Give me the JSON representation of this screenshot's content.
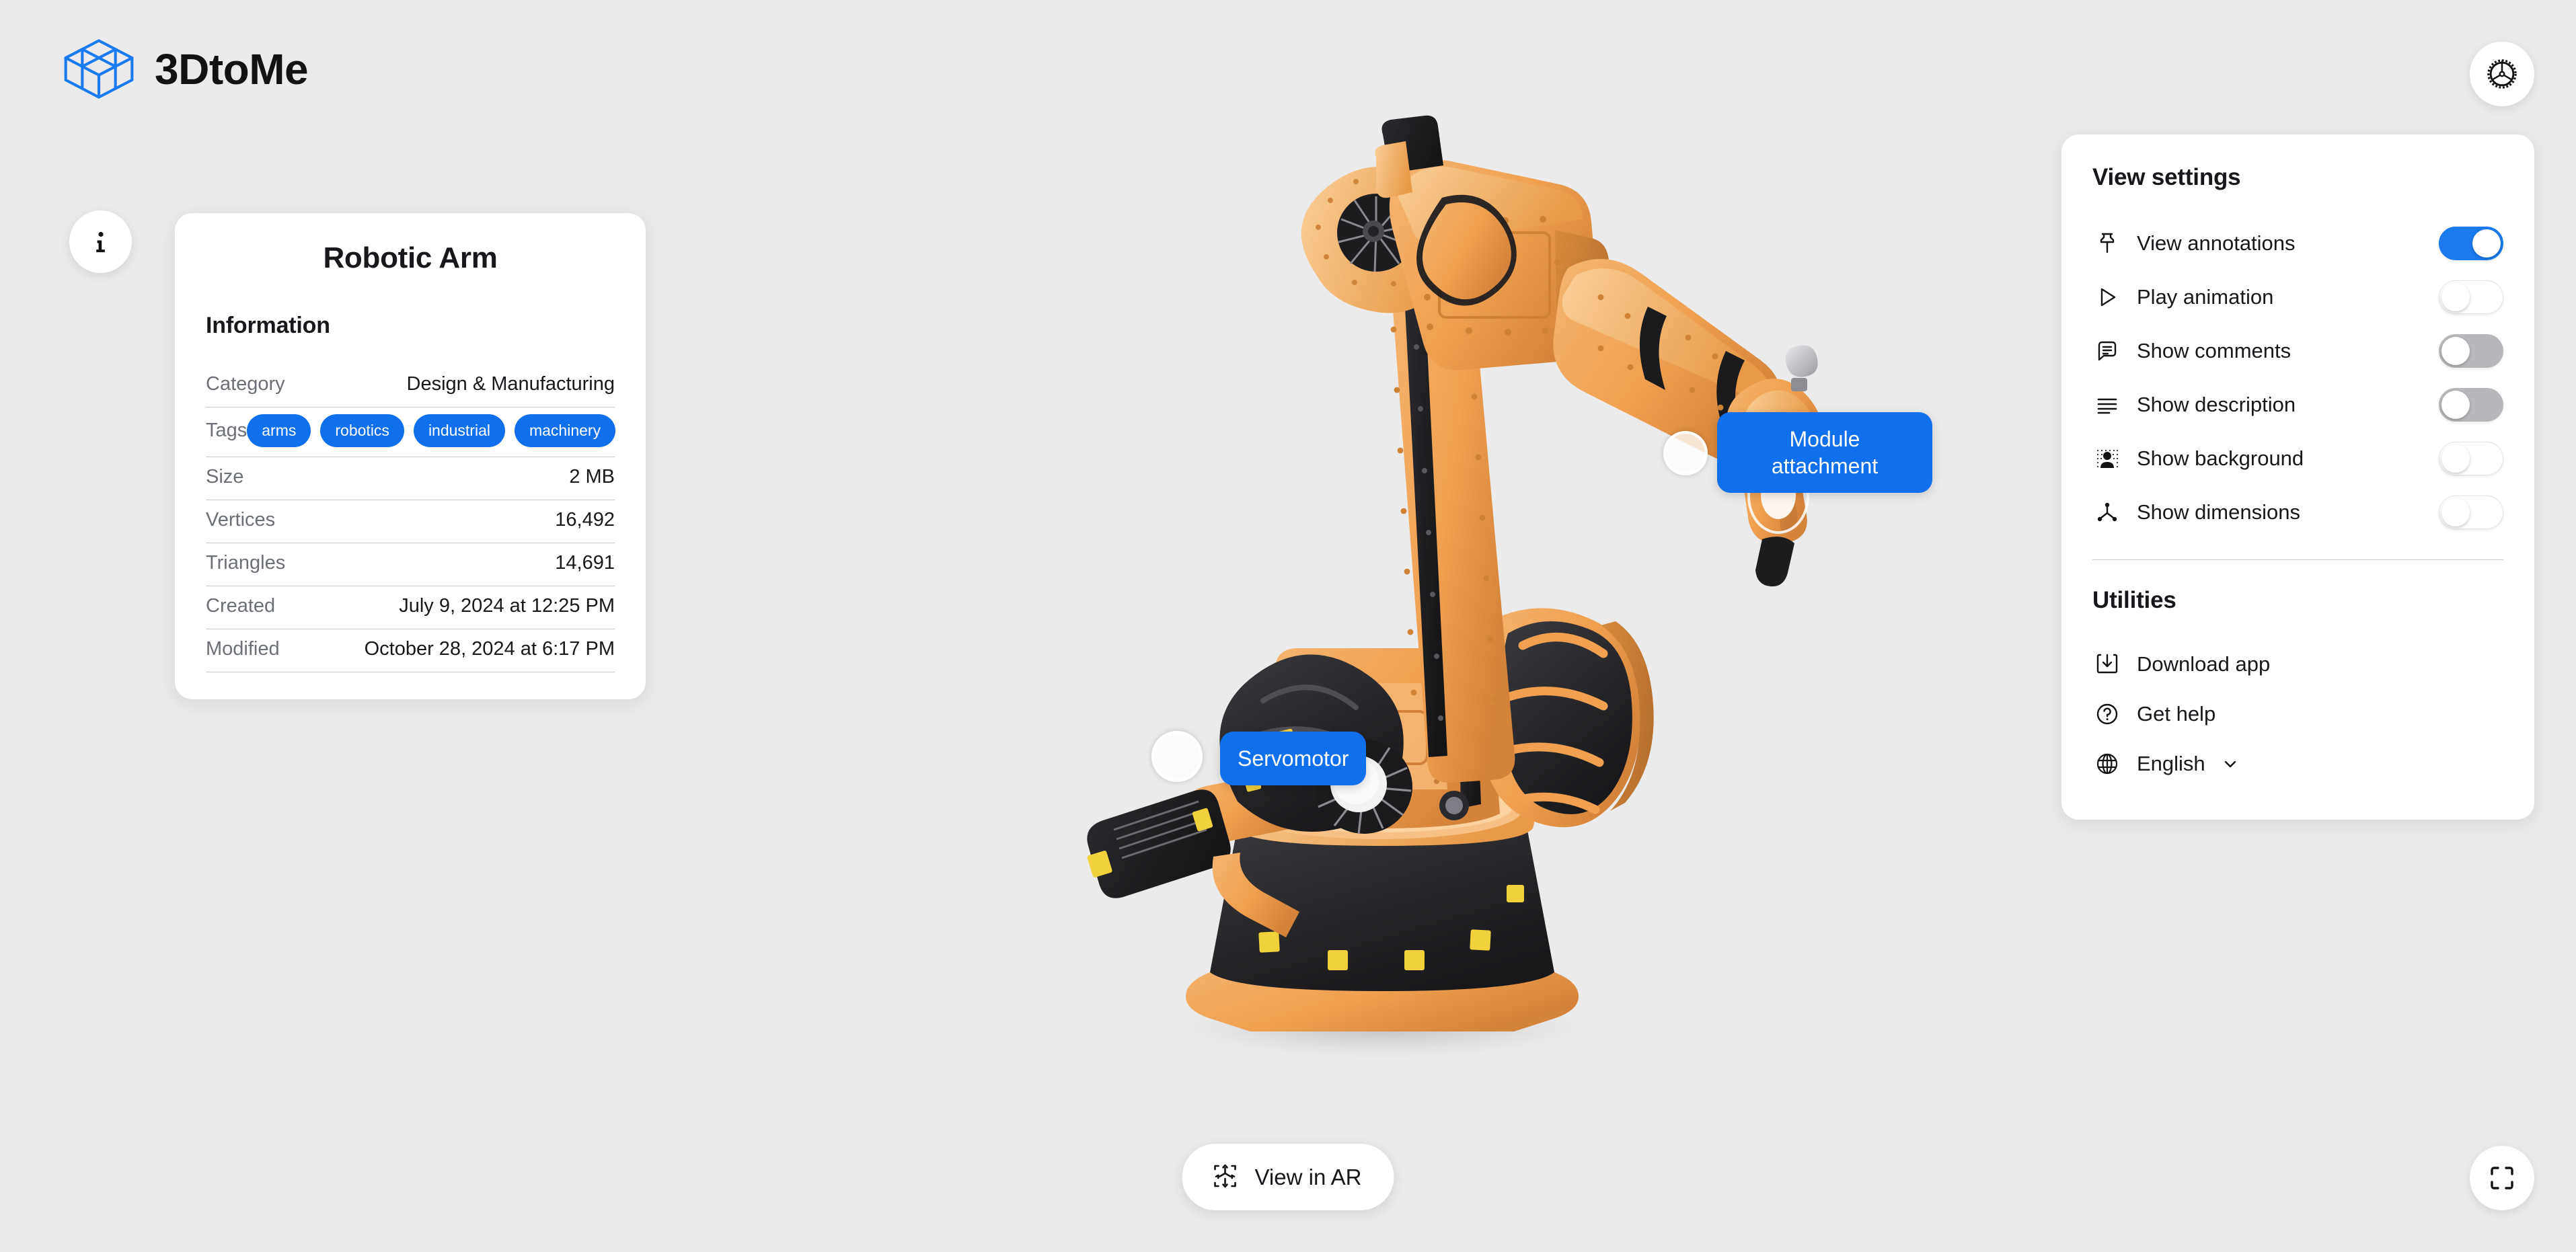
{
  "brand": {
    "name": "3DtoMe",
    "logo_icon": "isometric-cube-logo",
    "logo_color": "#1a7aee"
  },
  "colors": {
    "background": "#ebebeb",
    "accent": "#0f6fec",
    "toggle_on": "#1a7aee",
    "toggle_muted": "#b6b8bb",
    "card": "#ffffff",
    "text": "#16181c",
    "muted_text": "#6b6f76",
    "model_orange": "#f0a050",
    "model_black": "#232326",
    "model_yellow": "#f2d23c"
  },
  "top_bar": {
    "settings_button_icon": "gear-icon",
    "settings_button_label": "Settings"
  },
  "info_panel": {
    "toggle_icon": "info-icon",
    "title": "Robotic Arm",
    "section_title": "Information",
    "rows": [
      {
        "label": "Category",
        "value": "Design & Manufacturing"
      },
      {
        "label": "Size",
        "value": "2 MB"
      },
      {
        "label": "Vertices",
        "value": "16,492"
      },
      {
        "label": "Triangles",
        "value": "14,691"
      },
      {
        "label": "Created",
        "value": "July 9, 2024 at 12:25 PM"
      },
      {
        "label": "Modified",
        "value": "October 28, 2024 at 6:17 PM"
      }
    ],
    "tags_label": "Tags",
    "tags": [
      "arms",
      "robotics",
      "industrial",
      "machinery"
    ]
  },
  "settings_panel": {
    "view_settings_title": "View settings",
    "settings": [
      {
        "label": "View annotations",
        "icon": "pin-icon",
        "state": "on"
      },
      {
        "label": "Play animation",
        "icon": "play-icon",
        "state": "off"
      },
      {
        "label": "Show comments",
        "icon": "comment-icon",
        "state": "muted"
      },
      {
        "label": "Show description",
        "icon": "list-lines-icon",
        "state": "muted"
      },
      {
        "label": "Show background",
        "icon": "person-halftone-icon",
        "state": "off"
      },
      {
        "label": "Show dimensions",
        "icon": "nodes-icon",
        "state": "off"
      }
    ],
    "utilities_title": "Utilities",
    "utilities": [
      {
        "label": "Download app",
        "icon": "download-icon"
      },
      {
        "label": "Get help",
        "icon": "question-circle-icon"
      }
    ],
    "language": {
      "icon": "globe-icon",
      "value": "English",
      "chevron": "chevron-down-icon"
    }
  },
  "viewer": {
    "ar_button_label": "View in AR",
    "ar_button_icon": "ar-cube-icon",
    "fullscreen_button_icon": "fullscreen-icon",
    "annotations": [
      {
        "label": "Module attachment",
        "marker": "annotation-marker"
      },
      {
        "label": "Servomotor",
        "marker": "annotation-marker"
      }
    ],
    "model_name": "robotic-arm-3d-model"
  }
}
